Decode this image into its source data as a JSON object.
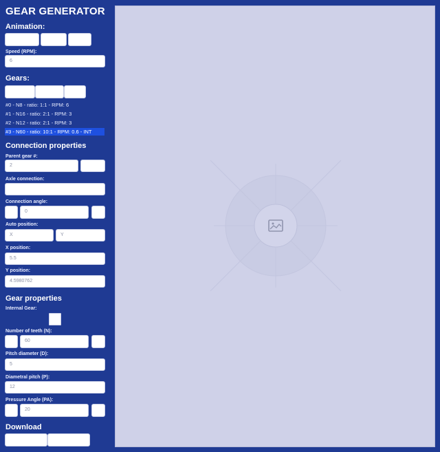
{
  "app": {
    "title": "GEAR GENERATOR"
  },
  "animation": {
    "heading": "Animation:",
    "speed_label": "Speed (RPM):",
    "speed_value": "6"
  },
  "gears": {
    "heading": "Gears:",
    "items": [
      "#0 - N8 - ratio: 1:1 - RPM: 6",
      "#1 - N16 - ratio: 2:1 - RPM: 3",
      "#2 - N12 - ratio: 2:1 - RPM: 3",
      "#3 - N60 - ratio: 10:1 - RPM: 0.6 - INT"
    ],
    "selected_index": 3
  },
  "connection": {
    "heading": "Connection properties",
    "parent_label": "Parent gear #:",
    "parent_value": "2",
    "axle_label": "Axle connection:",
    "angle_label": "Connection angle:",
    "angle_value": "0",
    "auto_label": "Auto position:",
    "auto_x_placeholder": "X",
    "auto_y_placeholder": "Y",
    "x_label": "X position:",
    "x_value": "5.5",
    "y_label": "Y position:",
    "y_value": "4.5980762"
  },
  "gear_props": {
    "heading": "Gear properties",
    "internal_label": "Internal Gear:",
    "teeth_label": "Number of teeth (N):",
    "teeth_value": "60",
    "pitch_d_label": "Pitch diameter (D):",
    "pitch_d_value": "5",
    "diametral_label": "Diametral pitch (P):",
    "diametral_value": "12",
    "pressure_label": "Pressure Angle (PA):",
    "pressure_value": "20"
  },
  "download": {
    "heading": "Download"
  },
  "canvas": {
    "icon": "image-placeholder-icon"
  }
}
